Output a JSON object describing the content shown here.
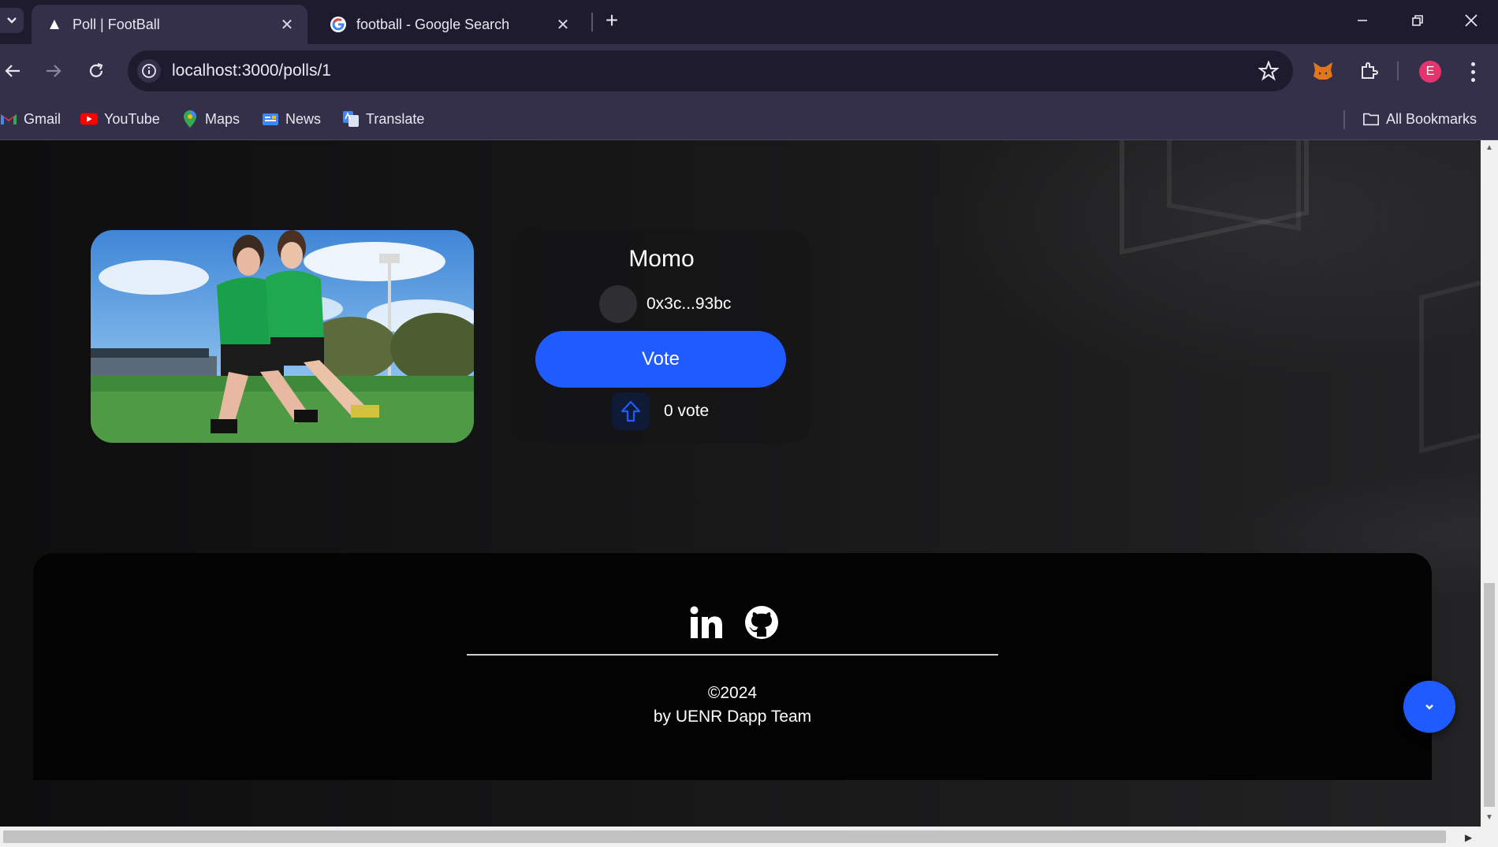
{
  "browser": {
    "tabs": [
      {
        "title": "Poll | FootBall",
        "active": true
      },
      {
        "title": "football - Google Search",
        "active": false
      }
    ],
    "url": "localhost:3000/polls/1",
    "profile_initial": "E",
    "bookmarks": [
      {
        "label": "Gmail",
        "icon": "gmail-icon"
      },
      {
        "label": "YouTube",
        "icon": "youtube-icon"
      },
      {
        "label": "Maps",
        "icon": "maps-icon"
      },
      {
        "label": "News",
        "icon": "news-icon"
      },
      {
        "label": "Translate",
        "icon": "translate-icon"
      }
    ],
    "all_bookmarks_label": "All Bookmarks"
  },
  "poll": {
    "contestant_name": "Momo",
    "address": "0x3c...93bc",
    "vote_button_label": "Vote",
    "vote_count_label": "0 vote",
    "vote_count": 0
  },
  "footer": {
    "copyright": "©2024",
    "team": "by UENR Dapp Team",
    "social_icons": [
      "linkedin-icon",
      "github-icon"
    ]
  },
  "colors": {
    "accent": "#1f5bff",
    "tab_bar": "#1f1b2e",
    "toolbar": "#35304a",
    "page_bg": "#0f0f10"
  }
}
